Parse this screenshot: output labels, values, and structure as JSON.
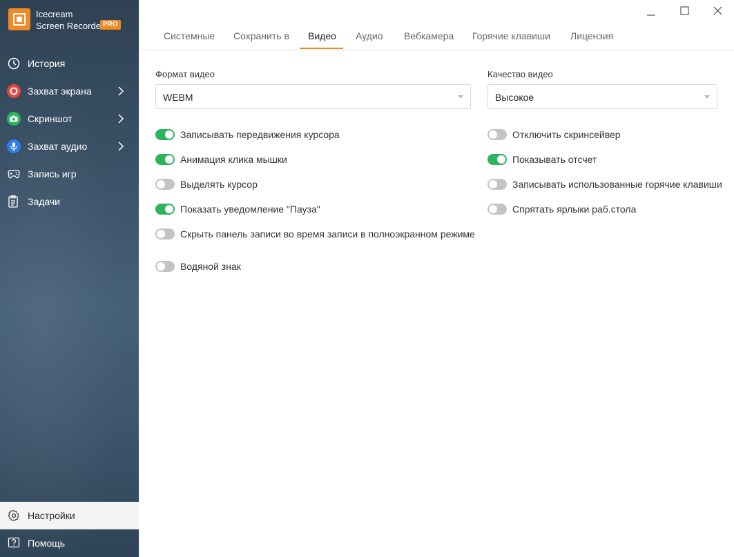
{
  "app": {
    "name_line1": "Icecream",
    "name_line2": "Screen Recorder",
    "badge": "PRO"
  },
  "sidebar": {
    "items": [
      {
        "label": "История",
        "icon": "clock-icon"
      },
      {
        "label": "Захват экрана",
        "icon": "record-icon"
      },
      {
        "label": "Скриншот",
        "icon": "camera-icon"
      },
      {
        "label": "Захват аудио",
        "icon": "microphone-icon"
      },
      {
        "label": "Запись игр",
        "icon": "gamepad-icon"
      },
      {
        "label": "Задачи",
        "icon": "tasks-icon"
      }
    ],
    "bottom": [
      {
        "label": "Настройки",
        "icon": "gear-icon"
      },
      {
        "label": "Помощь",
        "icon": "help-icon"
      }
    ]
  },
  "tabs": [
    "Системные",
    "Сохранить в",
    "Видео",
    "Аудио",
    "Вебкамера",
    "Горячие клавиши",
    "Лицензия"
  ],
  "active_tab": "Видео",
  "video_format": {
    "label": "Формат видео",
    "value": "WEBM"
  },
  "video_quality": {
    "label": "Качество видео",
    "value": "Высокое"
  },
  "left_options": [
    {
      "label": "Записывать передвижения курсора",
      "on": true
    },
    {
      "label": "Анимация клика мышки",
      "on": true
    },
    {
      "label": "Выделять курсор",
      "on": false
    },
    {
      "label": "Показать уведомление \"Пауза\"",
      "on": true
    },
    {
      "label": "Скрыть панель записи во время записи в полноэкранном режиме",
      "on": false
    },
    {
      "label": "Водяной знак",
      "on": false
    }
  ],
  "right_options": [
    {
      "label": "Отключить скринсейвер",
      "on": false
    },
    {
      "label": "Показывать отсчет",
      "on": true
    },
    {
      "label": "Записывать использованные горячие клавиши",
      "on": false
    },
    {
      "label": "Спрятать ярлыки раб.стола",
      "on": false
    }
  ],
  "colors": {
    "accent": "#f08a24",
    "toggle_on": "#2bb45c",
    "toggle_off": "#c4c4c4"
  }
}
